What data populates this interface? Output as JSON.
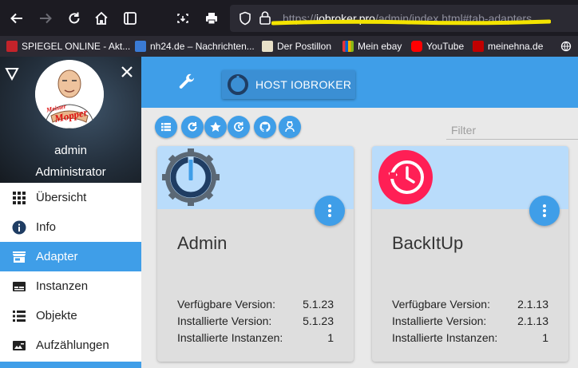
{
  "browser": {
    "url_protocol": "https://",
    "url_host": "iobroker.pro",
    "url_path": "/admin/index.html#tab-adapters",
    "bookmarks": [
      {
        "label": "SPIEGEL ONLINE - Akt...",
        "color": "#c4232a"
      },
      {
        "label": "nh24.de – Nachrichten...",
        "color": "#3a7bd5"
      },
      {
        "label": "Der Postillon",
        "color": "#e8e0c8"
      },
      {
        "label": "Mein ebay",
        "color": "#f5af02"
      },
      {
        "label": "YouTube",
        "color": "#ff0000"
      },
      {
        "label": "meinehna.de",
        "color": "#c00000"
      }
    ]
  },
  "drawer": {
    "avatar_text_1": "Meister",
    "avatar_text_2": "Mopper",
    "user_name": "admin",
    "user_role": "Administrator",
    "items": [
      {
        "label": "Übersicht",
        "icon": "grid-icon"
      },
      {
        "label": "Info",
        "icon": "info-icon"
      },
      {
        "label": "Adapter",
        "icon": "store-icon",
        "active": true
      },
      {
        "label": "Instanzen",
        "icon": "instances-icon"
      },
      {
        "label": "Objekte",
        "icon": "list-icon"
      },
      {
        "label": "Aufzählungen",
        "icon": "enums-icon"
      }
    ]
  },
  "header": {
    "host_button": "HOST IOBROKER"
  },
  "toolbar": {
    "filter_placeholder": "Filter"
  },
  "adapters": [
    {
      "name": "Admin",
      "available_label": "Verfügbare Version:",
      "available": "5.1.23",
      "installed_label": "Installierte Version:",
      "installed": "5.1.23",
      "instances_label": "Installierte Instanzen:",
      "instances": "1"
    },
    {
      "name": "BackItUp",
      "available_label": "Verfügbare Version:",
      "available": "2.1.13",
      "installed_label": "Installierte Version:",
      "installed": "2.1.13",
      "instances_label": "Installierte Instanzen:",
      "instances": "1"
    }
  ],
  "colors": {
    "accent": "#3f9ee8",
    "card_header": "#b9dcfb",
    "url_highlight": "#f4e400"
  }
}
